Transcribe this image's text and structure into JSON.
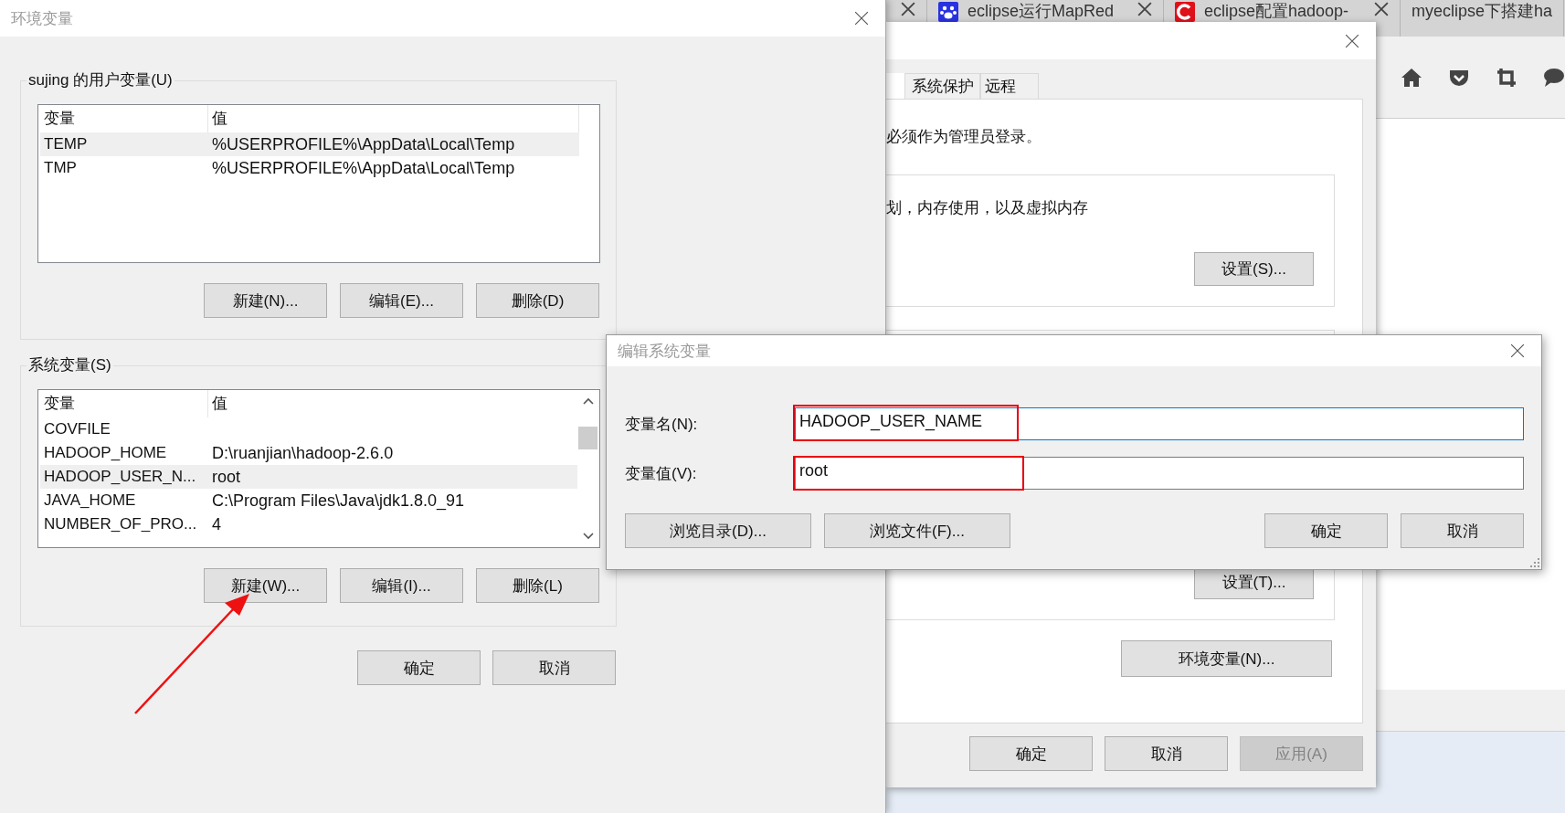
{
  "browser": {
    "tabs": [
      {
        "title": "eclipse运行MapRed"
      },
      {
        "title": "eclipse配置hadoop-"
      },
      {
        "title": "myeclipse下搭建ha"
      }
    ]
  },
  "system_properties": {
    "tabs": [
      {
        "label": "系统保护",
        "selected": false
      },
      {
        "label": "远程",
        "selected": false
      }
    ],
    "admin_note": "必须作为管理员登录。",
    "performance": {
      "text": "划，内存使用，以及虚拟内存",
      "button": "设置(S)..."
    },
    "startup": {
      "button": "设置(T)..."
    },
    "env_button": "环境变量(N)...",
    "buttons": [
      {
        "label": "确定",
        "disabled": false
      },
      {
        "label": "取消",
        "disabled": false
      },
      {
        "label": "应用(A)",
        "disabled": true
      }
    ]
  },
  "env_dialog": {
    "title": "环境变量",
    "user_vars": {
      "label": "sujing 的用户变量(U)",
      "columns": [
        "变量",
        "值"
      ],
      "rows": [
        {
          "name": "TEMP",
          "value": "%USERPROFILE%\\AppData\\Local\\Temp",
          "selected": true
        },
        {
          "name": "TMP",
          "value": "%USERPROFILE%\\AppData\\Local\\Temp",
          "selected": false
        }
      ],
      "buttons": [
        "新建(N)...",
        "编辑(E)...",
        "删除(D)"
      ]
    },
    "system_vars": {
      "label": "系统变量(S)",
      "columns": [
        "变量",
        "值"
      ],
      "rows": [
        {
          "name": "COVFILE",
          "value": "",
          "selected": false
        },
        {
          "name": "HADOOP_HOME",
          "value": "D:\\ruanjian\\hadoop-2.6.0",
          "selected": false
        },
        {
          "name": "HADOOP_USER_N...",
          "value": "root",
          "selected": true
        },
        {
          "name": "JAVA_HOME",
          "value": "C:\\Program Files\\Java\\jdk1.8.0_91",
          "selected": false
        },
        {
          "name": "NUMBER_OF_PRO...",
          "value": "4",
          "selected": false
        }
      ],
      "buttons": [
        "新建(W)...",
        "编辑(I)...",
        "删除(L)"
      ]
    },
    "buttons": [
      "确定",
      "取消"
    ]
  },
  "edit_dialog": {
    "title": "编辑系统变量",
    "fields": [
      {
        "label": "变量名(N):",
        "value": "HADOOP_USER_NAME",
        "focused": true,
        "highlighted": true
      },
      {
        "label": "变量值(V):",
        "value": "root",
        "focused": false,
        "highlighted": true
      }
    ],
    "left_buttons": [
      "浏览目录(D)...",
      "浏览文件(F)..."
    ],
    "right_buttons": [
      "确定",
      "取消"
    ]
  }
}
